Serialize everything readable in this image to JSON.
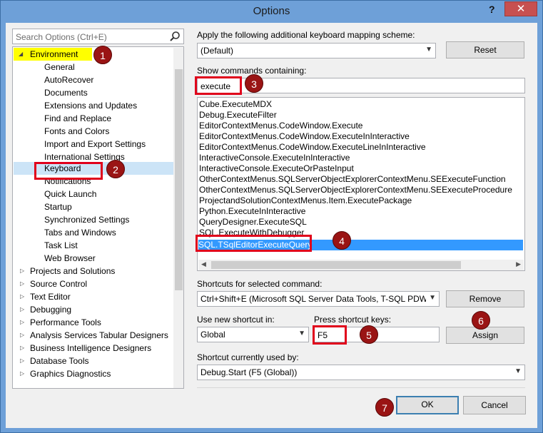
{
  "window": {
    "title": "Options",
    "help": "?",
    "close": "✕"
  },
  "search": {
    "placeholder": "Search Options (Ctrl+E)"
  },
  "tree": {
    "items": [
      {
        "label": "Environment",
        "expanded": true
      },
      {
        "label": "General"
      },
      {
        "label": "AutoRecover"
      },
      {
        "label": "Documents"
      },
      {
        "label": "Extensions and Updates"
      },
      {
        "label": "Find and Replace"
      },
      {
        "label": "Fonts and Colors"
      },
      {
        "label": "Import and Export Settings"
      },
      {
        "label": "International Settings"
      },
      {
        "label": "Keyboard",
        "selected": true
      },
      {
        "label": "Notifications"
      },
      {
        "label": "Quick Launch"
      },
      {
        "label": "Startup"
      },
      {
        "label": "Synchronized Settings"
      },
      {
        "label": "Tabs and Windows"
      },
      {
        "label": "Task List"
      },
      {
        "label": "Web Browser"
      },
      {
        "label": "Projects and Solutions"
      },
      {
        "label": "Source Control"
      },
      {
        "label": "Text Editor"
      },
      {
        "label": "Debugging"
      },
      {
        "label": "Performance Tools"
      },
      {
        "label": "Analysis Services Tabular Designers"
      },
      {
        "label": "Business Intelligence Designers"
      },
      {
        "label": "Database Tools"
      },
      {
        "label": "Graphics Diagnostics"
      }
    ]
  },
  "mapping": {
    "label": "Apply the following additional keyboard mapping scheme:",
    "value": "(Default)",
    "reset": "Reset"
  },
  "commands": {
    "label": "Show commands containing:",
    "filter": "execute",
    "items": [
      "Cube.ExecuteMDX",
      "Debug.ExecuteFilter",
      "EditorContextMenus.CodeWindow.Execute",
      "EditorContextMenus.CodeWindow.ExecuteInInteractive",
      "EditorContextMenus.CodeWindow.ExecuteLineInInteractive",
      "InteractiveConsole.ExecuteInInteractive",
      "InteractiveConsole.ExecuteOrPasteInput",
      "OtherContextMenus.SQLServerObjectExplorerContextMenu.SEExecuteFunction",
      "OtherContextMenus.SQLServerObjectExplorerContextMenu.SEExecuteProcedure",
      "ProjectandSolutionContextMenus.Item.ExecutePackage",
      "Python.ExecuteInInteractive",
      "QueryDesigner.ExecuteSQL",
      "SQL.ExecuteWithDebugger",
      "SQL.TSqlEditorExecuteQuery"
    ],
    "selected_index": 13
  },
  "shortcuts": {
    "label": "Shortcuts for selected command:",
    "value": "Ctrl+Shift+E (Microsoft SQL Server Data Tools, T-SQL PDW E",
    "remove": "Remove"
  },
  "new_shortcut": {
    "use_label": "Use new shortcut in:",
    "use_value": "Global",
    "press_label": "Press shortcut keys:",
    "press_value": "F5",
    "assign": "Assign"
  },
  "current": {
    "label": "Shortcut currently used by:",
    "value": "Debug.Start (F5 (Global))"
  },
  "footer": {
    "ok": "OK",
    "cancel": "Cancel"
  },
  "badges": [
    "1",
    "2",
    "3",
    "4",
    "5",
    "6",
    "7"
  ],
  "colors": {
    "titlebar": "#6ea0d8",
    "close": "#c75050",
    "selection": "#3399ff",
    "highlight": "#e0001b",
    "badge": "#9a1414",
    "marker": "#ffff00"
  }
}
